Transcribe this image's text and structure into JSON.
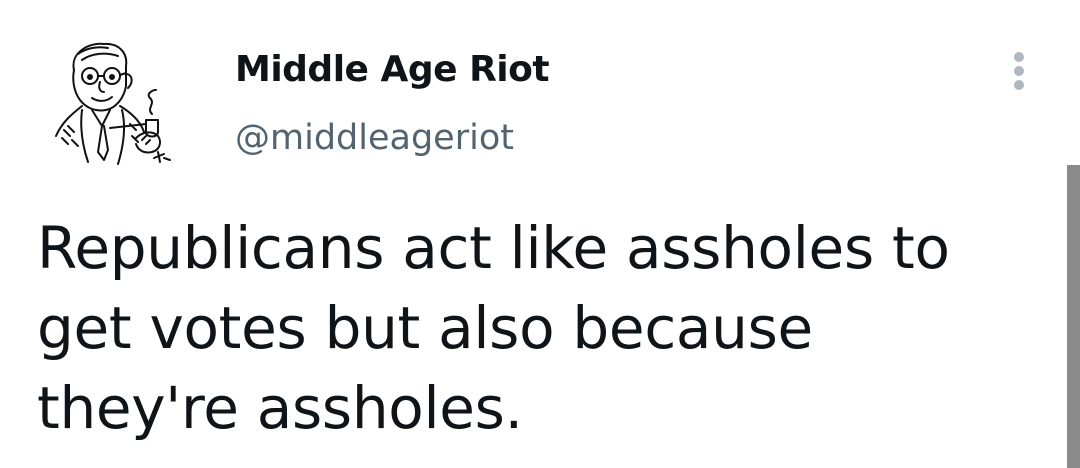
{
  "tweet": {
    "author": {
      "display_name": "Middle Age Riot",
      "handle": "@middleageriot",
      "avatar_icon": "vintage-man-with-pipe-illustration"
    },
    "more_icon": "more-vertical-icon",
    "text_lines": [
      "Republicans act like assholes to",
      "get votes but also because",
      "they're assholes."
    ]
  },
  "colors": {
    "text_primary": "#0f1419",
    "text_secondary": "#536471",
    "background": "#ffffff"
  }
}
